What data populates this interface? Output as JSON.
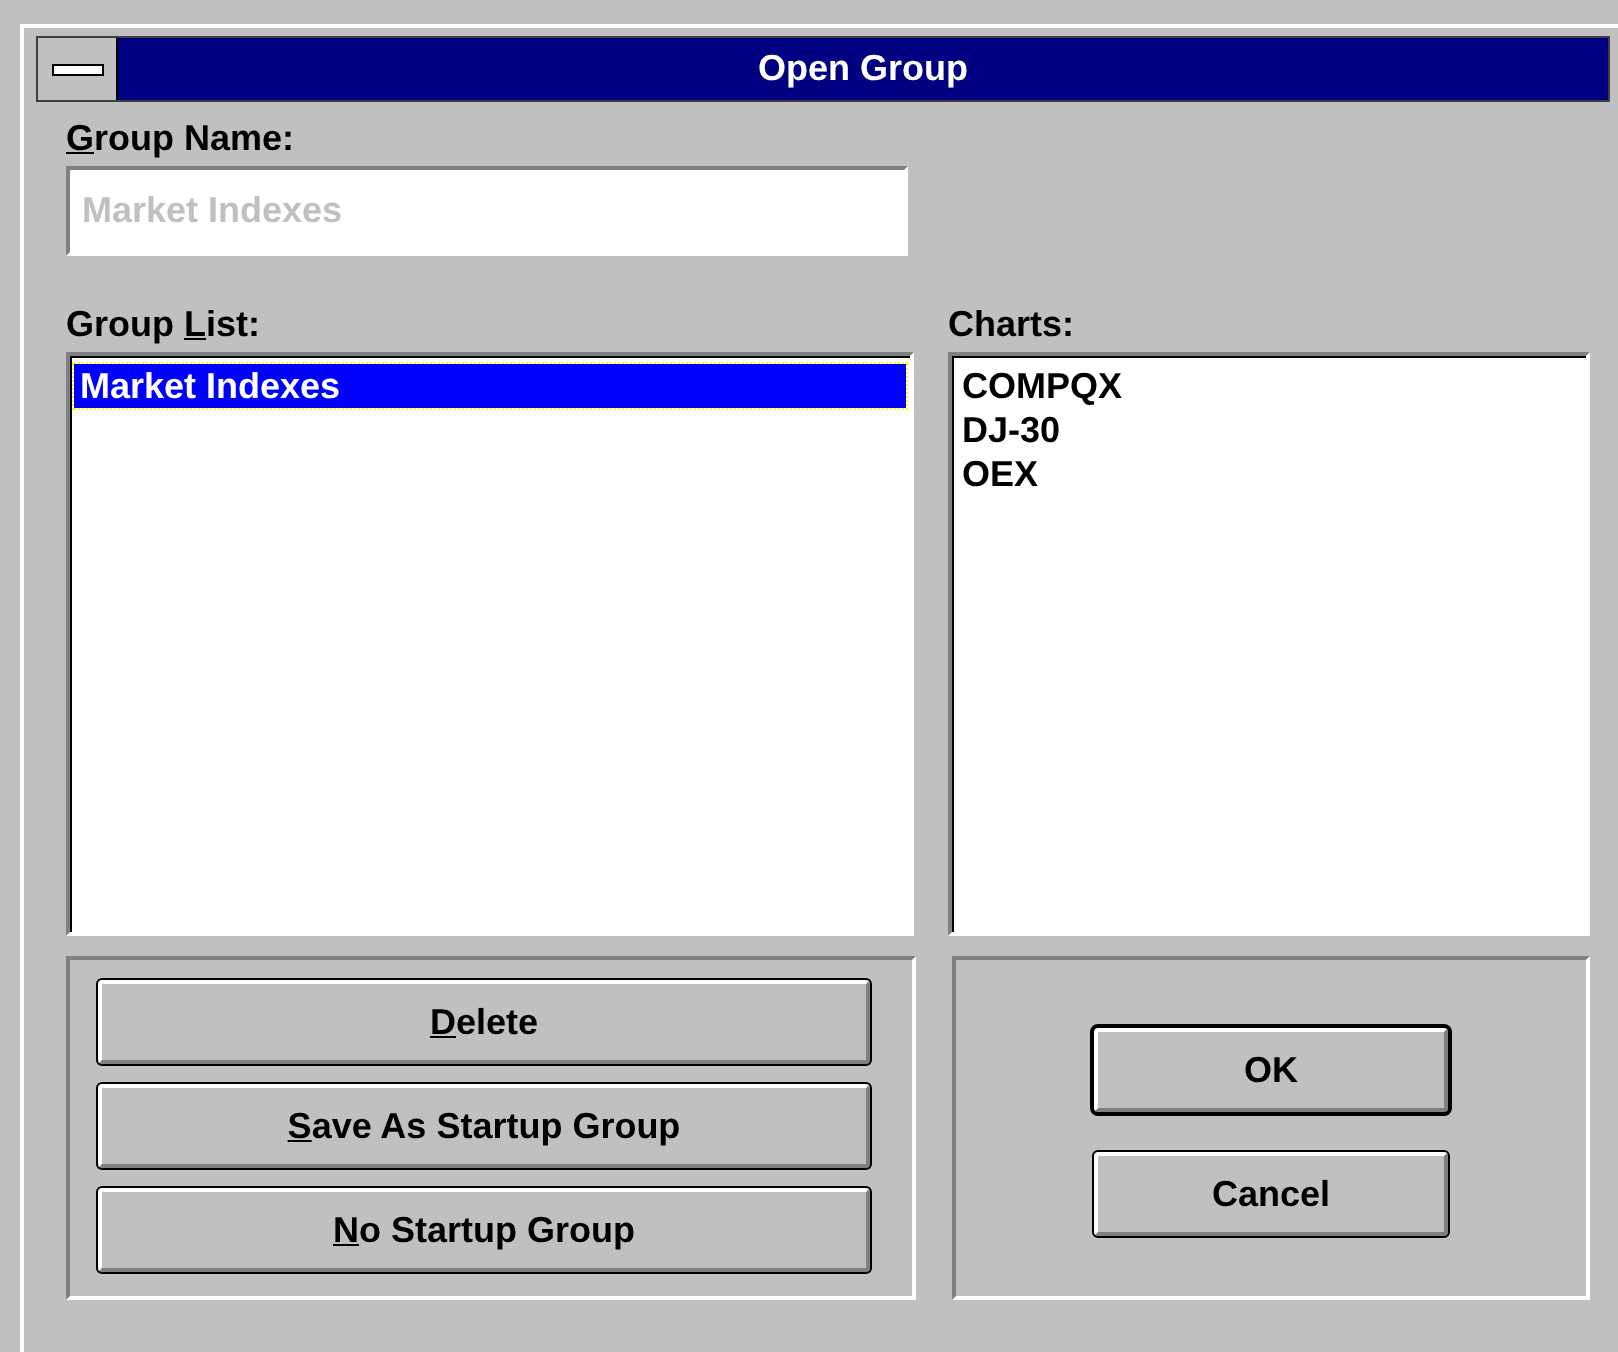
{
  "window": {
    "title": "Open Group"
  },
  "group_name": {
    "label": {
      "key": "G",
      "after": "roup Name:"
    },
    "value": "Market Indexes",
    "disabled": true
  },
  "group_list": {
    "label": {
      "before": "Group ",
      "key": "L",
      "after": "ist:"
    },
    "items": [
      {
        "text": "Market Indexes",
        "selected": true
      }
    ]
  },
  "charts": {
    "label": {
      "before": "Charts:"
    },
    "items": [
      {
        "text": "COMPQX",
        "selected": false
      },
      {
        "text": "DJ-30",
        "selected": false
      },
      {
        "text": "OEX",
        "selected": false
      }
    ]
  },
  "left_buttons": [
    {
      "key": "D",
      "after": "elete"
    },
    {
      "key": "S",
      "after": "ave As Startup Group"
    },
    {
      "key": "N",
      "after": "o Startup Group"
    }
  ],
  "right_buttons": [
    {
      "label": "OK",
      "default": true
    },
    {
      "label": "Cancel",
      "default": false
    }
  ]
}
